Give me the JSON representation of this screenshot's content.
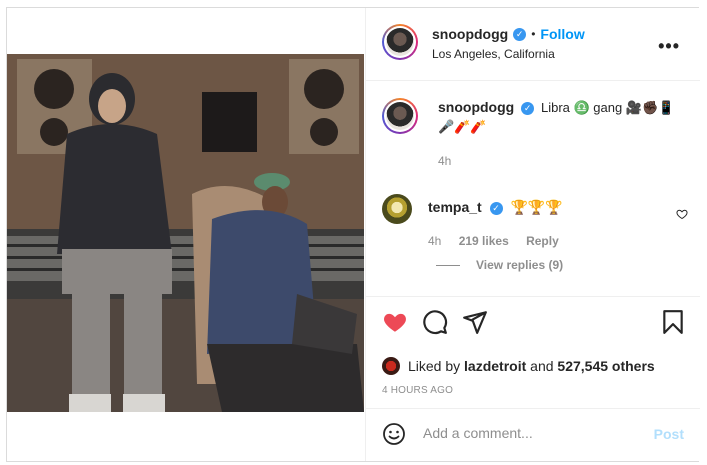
{
  "header": {
    "username": "snoopdogg",
    "follow_label": "Follow",
    "separator": "•",
    "location": "Los Angeles, California",
    "more_label": "•••"
  },
  "caption": {
    "username": "snoopdogg",
    "text_a": "Libra ♎ gang 🎥✊🏿📱",
    "text_b": "🎤🧨🧨",
    "time": "4h"
  },
  "comment": {
    "username": "tempa_t",
    "text": "🏆🏆🏆",
    "time": "4h",
    "likes": "219 likes",
    "reply_label": "Reply"
  },
  "view_replies": "View replies (9)",
  "likes": {
    "prefix": "Liked by",
    "user": "lazdetroit",
    "and": "and",
    "count": "527,545 others"
  },
  "post_time": "4 HOURS AGO",
  "add_comment": {
    "placeholder": "Add a comment...",
    "post_label": "Post"
  },
  "colors": {
    "heart_red": "#ed4956",
    "link_blue": "#0095f6",
    "post_disabled": "#b2dffc",
    "verified": "#3897f0"
  },
  "icons": [
    "more-options-icon",
    "verified-icon",
    "heart-icon",
    "comment-icon",
    "share-icon",
    "save-icon",
    "emoji-icon"
  ]
}
